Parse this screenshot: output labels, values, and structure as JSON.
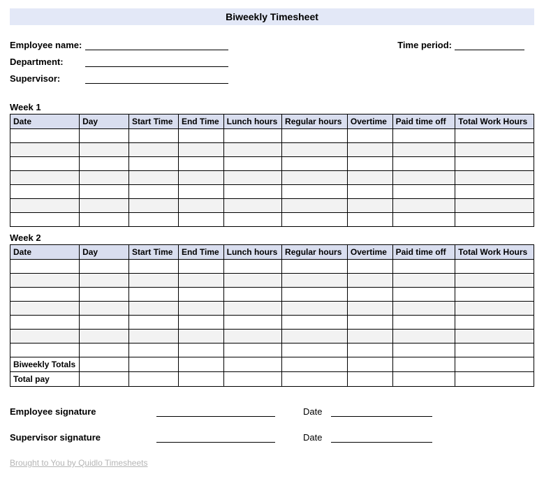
{
  "title": "Biweekly Timesheet",
  "header": {
    "employee_name_label": "Employee name:",
    "department_label": "Department:",
    "supervisor_label": "Supervisor:",
    "time_period_label": "Time period:",
    "employee_name": "",
    "department": "",
    "supervisor": "",
    "time_period": ""
  },
  "columns": {
    "date": "Date",
    "day": "Day",
    "start": "Start Time",
    "end": "End Time",
    "lunch": "Lunch hours",
    "regular": "Regular hours",
    "overtime": "Overtime",
    "pto": "Paid time off",
    "total": "Total Work Hours"
  },
  "week1": {
    "label": "Week 1",
    "rows": [
      {
        "date": "",
        "day": "",
        "start": "",
        "end": "",
        "lunch": "",
        "regular": "",
        "overtime": "",
        "pto": "",
        "total": ""
      },
      {
        "date": "",
        "day": "",
        "start": "",
        "end": "",
        "lunch": "",
        "regular": "",
        "overtime": "",
        "pto": "",
        "total": ""
      },
      {
        "date": "",
        "day": "",
        "start": "",
        "end": "",
        "lunch": "",
        "regular": "",
        "overtime": "",
        "pto": "",
        "total": ""
      },
      {
        "date": "",
        "day": "",
        "start": "",
        "end": "",
        "lunch": "",
        "regular": "",
        "overtime": "",
        "pto": "",
        "total": ""
      },
      {
        "date": "",
        "day": "",
        "start": "",
        "end": "",
        "lunch": "",
        "regular": "",
        "overtime": "",
        "pto": "",
        "total": ""
      },
      {
        "date": "",
        "day": "",
        "start": "",
        "end": "",
        "lunch": "",
        "regular": "",
        "overtime": "",
        "pto": "",
        "total": ""
      },
      {
        "date": "",
        "day": "",
        "start": "",
        "end": "",
        "lunch": "",
        "regular": "",
        "overtime": "",
        "pto": "",
        "total": ""
      }
    ]
  },
  "week2": {
    "label": "Week 2",
    "rows": [
      {
        "date": "",
        "day": "",
        "start": "",
        "end": "",
        "lunch": "",
        "regular": "",
        "overtime": "",
        "pto": "",
        "total": ""
      },
      {
        "date": "",
        "day": "",
        "start": "",
        "end": "",
        "lunch": "",
        "regular": "",
        "overtime": "",
        "pto": "",
        "total": ""
      },
      {
        "date": "",
        "day": "",
        "start": "",
        "end": "",
        "lunch": "",
        "regular": "",
        "overtime": "",
        "pto": "",
        "total": ""
      },
      {
        "date": "",
        "day": "",
        "start": "",
        "end": "",
        "lunch": "",
        "regular": "",
        "overtime": "",
        "pto": "",
        "total": ""
      },
      {
        "date": "",
        "day": "",
        "start": "",
        "end": "",
        "lunch": "",
        "regular": "",
        "overtime": "",
        "pto": "",
        "total": ""
      },
      {
        "date": "",
        "day": "",
        "start": "",
        "end": "",
        "lunch": "",
        "regular": "",
        "overtime": "",
        "pto": "",
        "total": ""
      },
      {
        "date": "",
        "day": "",
        "start": "",
        "end": "",
        "lunch": "",
        "regular": "",
        "overtime": "",
        "pto": "",
        "total": ""
      }
    ]
  },
  "totals": {
    "biweekly_label": "Biweekly Totals",
    "biweekly": {
      "day": "",
      "start": "",
      "end": "",
      "lunch": "",
      "regular": "",
      "overtime": "",
      "pto": "",
      "total": ""
    },
    "totalpay_label": "Total pay",
    "totalpay": {
      "day": "",
      "start": "",
      "end": "",
      "lunch": "",
      "regular": "",
      "overtime": "",
      "pto": "",
      "total": ""
    }
  },
  "signatures": {
    "employee_label": "Employee signature",
    "supervisor_label": "Supervisor signature",
    "date_label": "Date",
    "employee_sig": "",
    "employee_date": "",
    "supervisor_sig": "",
    "supervisor_date": ""
  },
  "footer": {
    "link_text": "Brought to You by Quidlo Timesheets"
  }
}
